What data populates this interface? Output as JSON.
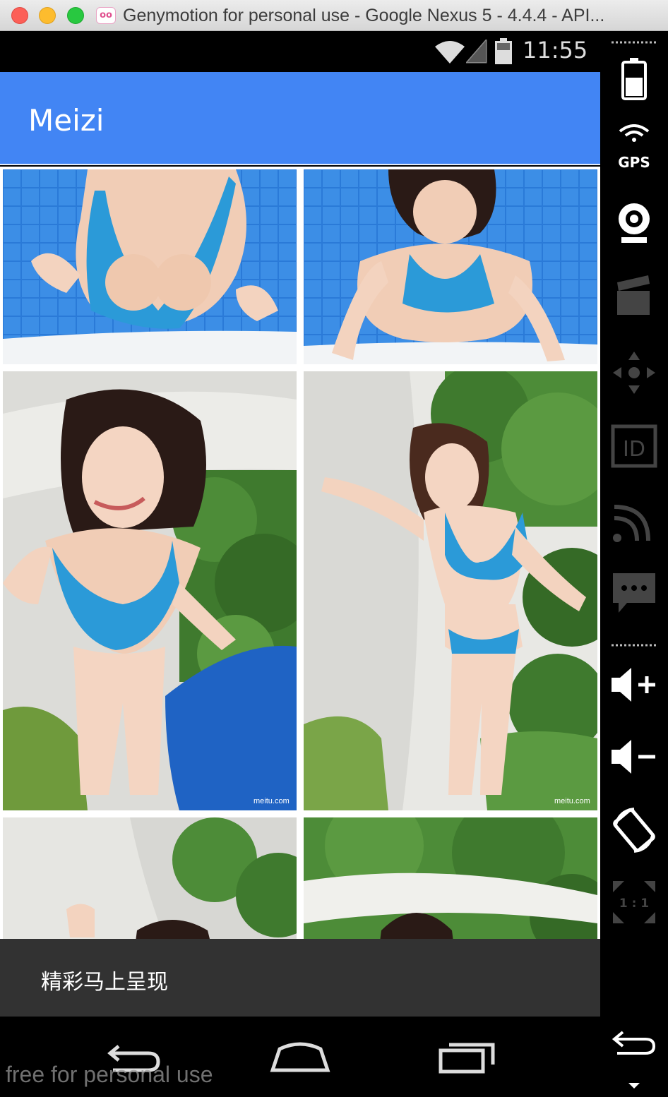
{
  "window": {
    "title": "Genymotion for personal use - Google Nexus 5 - 4.4.4 - API...",
    "app_logo": "oo"
  },
  "statusbar": {
    "time": "11:55"
  },
  "appbar": {
    "title": "Meizi"
  },
  "gallery": {
    "photos": [
      {
        "alt": "pool-photo-1"
      },
      {
        "alt": "pool-photo-2"
      },
      {
        "alt": "garden-photo-3"
      },
      {
        "alt": "garden-photo-4"
      },
      {
        "alt": "garden-photo-5"
      },
      {
        "alt": "garden-photo-6"
      }
    ],
    "photo_watermark": "meitu.com"
  },
  "snackbar": {
    "message": "精彩马上呈现"
  },
  "navbar": {
    "back": "back-icon",
    "home": "home-icon",
    "recents": "recents-icon"
  },
  "watermark": "free for personal use",
  "sidebar": {
    "gps_label": "GPS",
    "id_label": "ID",
    "pixel_label": "1 : 1",
    "tools": [
      "battery-icon",
      "gps-icon",
      "webcam-icon",
      "clapper-icon",
      "dpad-icon",
      "id-icon",
      "cast-icon",
      "sms-icon",
      "volume-up-icon",
      "volume-down-icon",
      "rotate-icon",
      "pixel-perfect-icon",
      "back-icon",
      "menu-down-icon"
    ]
  },
  "colors": {
    "appbar": "#4285f4",
    "snackbar": "#323232",
    "pool": "#1f6fd0",
    "foliage": "#3f7a2e",
    "wall": "#e6e6e2"
  }
}
